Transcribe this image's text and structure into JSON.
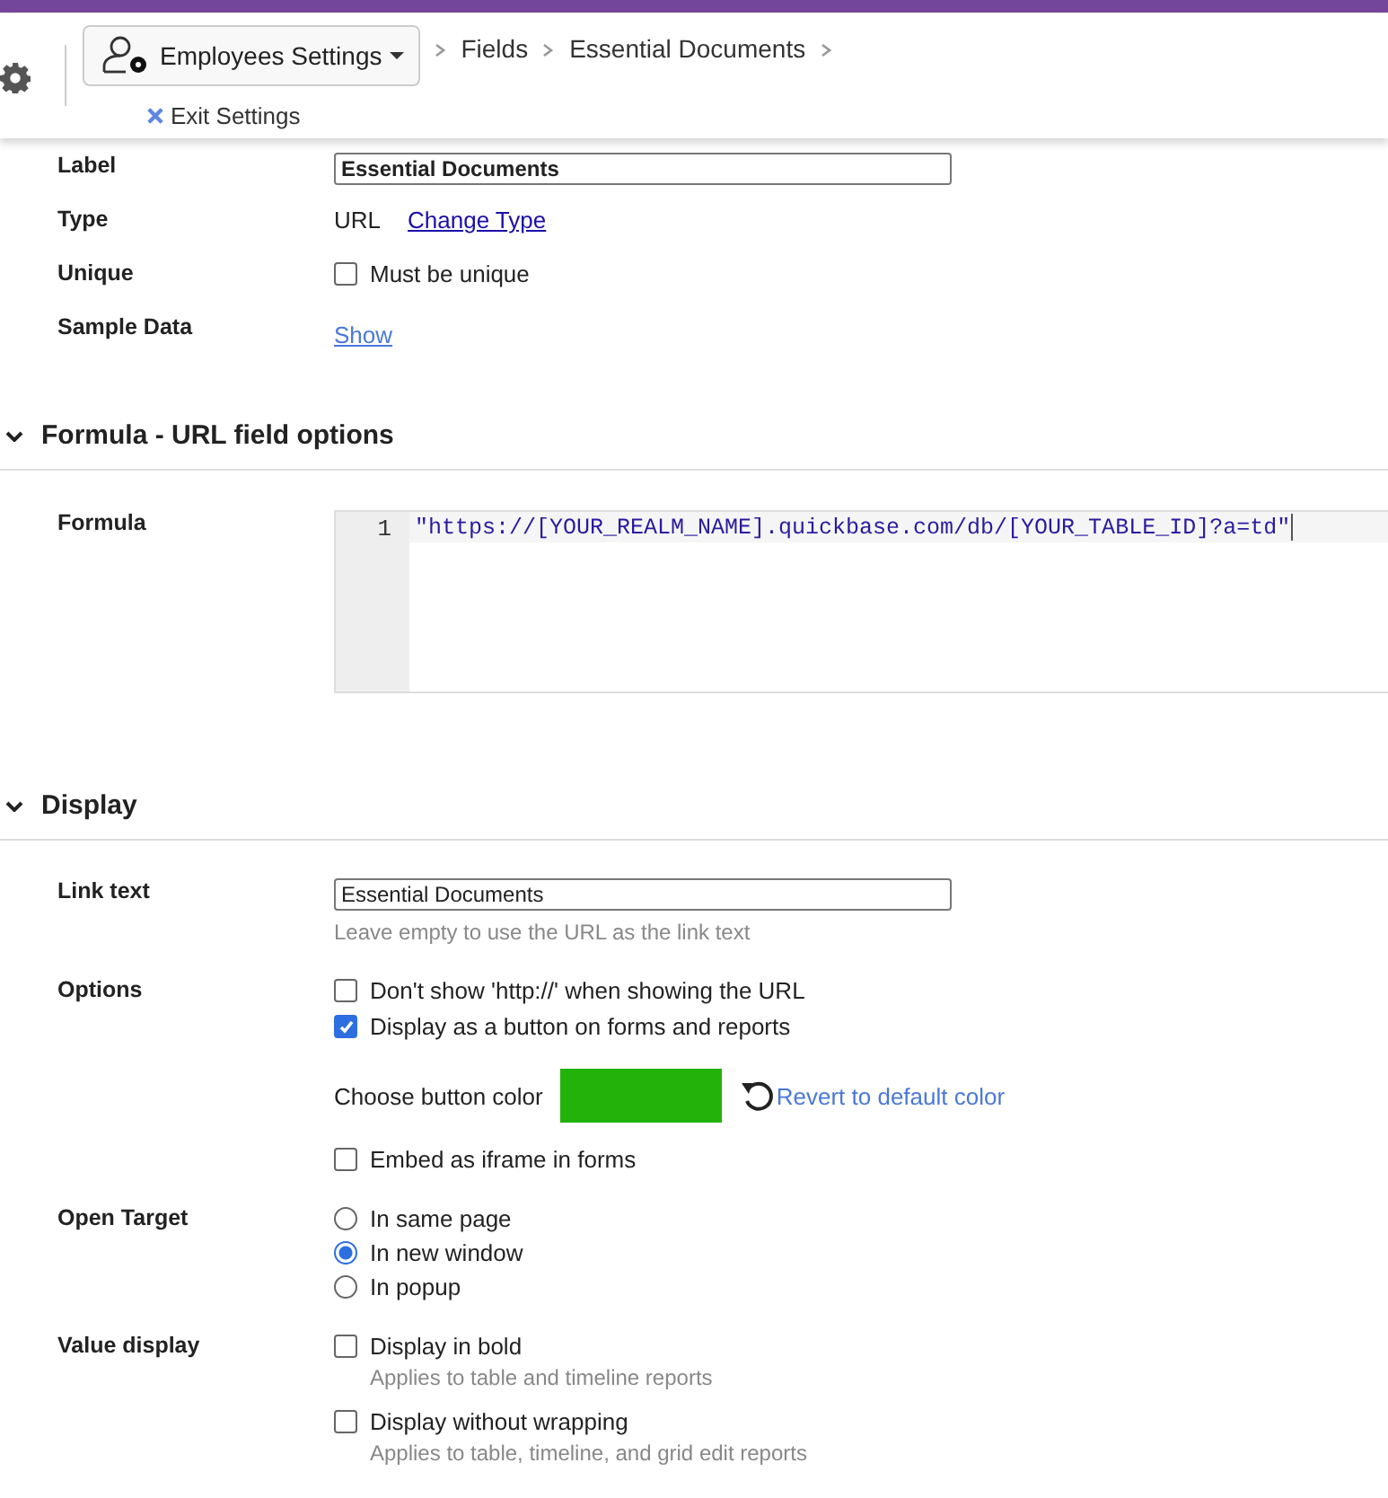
{
  "header": {
    "settings_menu": "Employees Settings",
    "breadcrumbs": [
      "Fields",
      "Essential Documents"
    ],
    "exit": "Exit Settings"
  },
  "properties": [
    {
      "kind": "input",
      "label": "Label",
      "value": "Essential Documents"
    },
    {
      "kind": "type",
      "label": "Type",
      "value": "URL",
      "link": "Change Type"
    },
    {
      "kind": "checkbox",
      "label": "Unique",
      "text": "Must be unique",
      "checked": false
    },
    {
      "kind": "link",
      "label": "Sample Data",
      "link": "Show"
    }
  ],
  "formula_section": {
    "title": "Formula - URL field options",
    "expanded": true,
    "label": "Formula",
    "line_number": "1",
    "code": "\"https://[YOUR_REALM_NAME].quickbase.com/db/[YOUR_TABLE_ID]?a=td\""
  },
  "display_section": {
    "title": "Display",
    "expanded": true,
    "link_text": {
      "label": "Link text",
      "value": "Essential Documents",
      "hint": "Leave empty to use the URL as the link text"
    },
    "options": {
      "label": "Options",
      "items": [
        {
          "kind": "checkbox",
          "text": "Don't show 'http://' when showing the URL",
          "checked": false
        },
        {
          "kind": "checkbox",
          "text": "Display as a button on forms and reports",
          "checked": true
        },
        {
          "kind": "color",
          "label": "Choose button color",
          "color": "#22b20a",
          "revert": "Revert to default color"
        },
        {
          "kind": "checkbox",
          "text": "Embed as iframe in forms",
          "checked": false
        }
      ]
    },
    "open_target": {
      "label": "Open Target",
      "choices": [
        {
          "text": "In same page",
          "selected": false
        },
        {
          "text": "In new window",
          "selected": true
        },
        {
          "text": "In popup",
          "selected": false
        }
      ]
    },
    "value_display": {
      "label": "Value display",
      "items": [
        {
          "text": "Display in bold",
          "hint": "Applies to table and timeline reports",
          "checked": false
        },
        {
          "text": "Display without wrapping",
          "hint": "Applies to table, timeline, and grid edit reports",
          "checked": false
        }
      ]
    }
  }
}
